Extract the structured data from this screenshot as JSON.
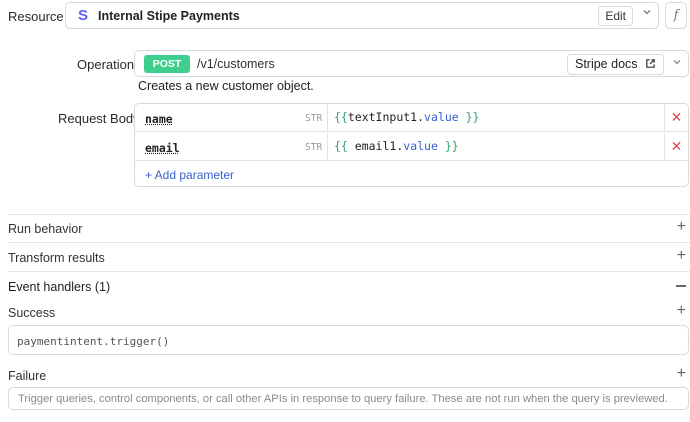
{
  "resource": {
    "label": "Resource",
    "icon": "stripe-s-icon",
    "icon_glyph": "S",
    "name": "Internal Stipe Payments",
    "edit_label": "Edit",
    "fx_label": "f"
  },
  "operation": {
    "label": "Operation",
    "method": "POST",
    "path": "/v1/customers",
    "docs_label": "Stripe docs",
    "description": "Creates a new customer object."
  },
  "request_body": {
    "label": "Request Body",
    "params": [
      {
        "key": "name",
        "type": "STR",
        "open": "{{",
        "ident": "textInput1",
        "dot": ".",
        "prop": "value",
        "close": " }}"
      },
      {
        "key": "email",
        "type": "STR",
        "open": "{{ ",
        "ident": "email1",
        "dot": ".",
        "prop": "value",
        "close": " }}"
      }
    ],
    "add_label": "+ Add parameter"
  },
  "sections": {
    "run_behavior": "Run behavior",
    "transform_results": "Transform results",
    "event_handlers": "Event handlers (1)"
  },
  "handlers": {
    "success_label": "Success",
    "success_value": "paymentintent.trigger()",
    "failure_label": "Failure",
    "failure_placeholder": "Trigger queries, control components, or call other APIs in response to query failure. These are not run when the query is previewed."
  },
  "colors": {
    "accent": "#3a5fcd",
    "post_badge": "#3ecf8e",
    "stripe": "#635bff",
    "delete": "#e5484d"
  }
}
